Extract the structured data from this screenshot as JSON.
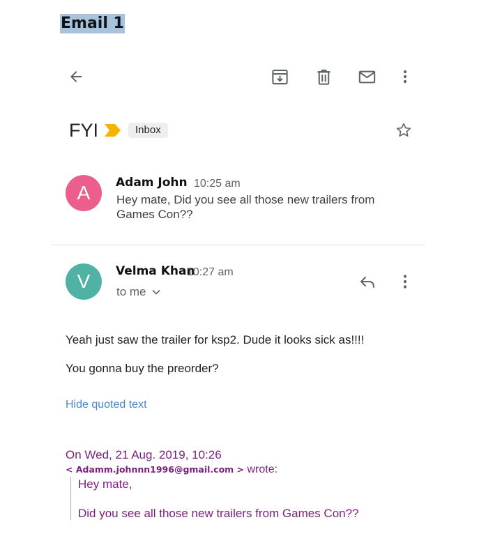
{
  "doc": {
    "title": "Email 1"
  },
  "toolbar": {
    "back_icon": "arrow-back-icon",
    "archive_icon": "archive-icon",
    "delete_icon": "delete-icon",
    "mark_unread_icon": "mail-icon",
    "more_icon": "more-vert-icon"
  },
  "thread": {
    "subject": "FYI",
    "importance_icon": "importance-marker-icon",
    "label": "Inbox",
    "star_icon": "star-outline-icon"
  },
  "messages": [
    {
      "avatar_letter": "A",
      "avatar_color": "#ec5e8b",
      "sender": "Adam John",
      "time": "10:25 am",
      "snippet": "Hey mate, Did you see all those new trailers from Games Con??"
    },
    {
      "avatar_letter": "V",
      "avatar_color": "#4fb2a5",
      "sender": "Velma Khan",
      "time": "10:27 am",
      "recipient": "to me",
      "reply_icon": "reply-icon",
      "more_icon": "more-vert-icon",
      "body": [
        "Yeah just saw the trailer for ksp2. Dude it looks sick as!!!!",
        "You gonna buy the preorder?"
      ],
      "hide_quoted": "Hide quoted text",
      "quote": {
        "date_line": "On Wed, 21 Aug. 2019, 10:26",
        "email": "< Adamm.johnnn1996@gmail.com >",
        "wrote": "wrote:",
        "lines": [
          "Hey mate,",
          "Did you see all those new trailers from Games Con??"
        ]
      }
    }
  ],
  "colors": {
    "importance": "#f4b400",
    "link": "#4a86c5",
    "quote": "#7b1f7f",
    "title_highlight": "#a9c3dc"
  }
}
